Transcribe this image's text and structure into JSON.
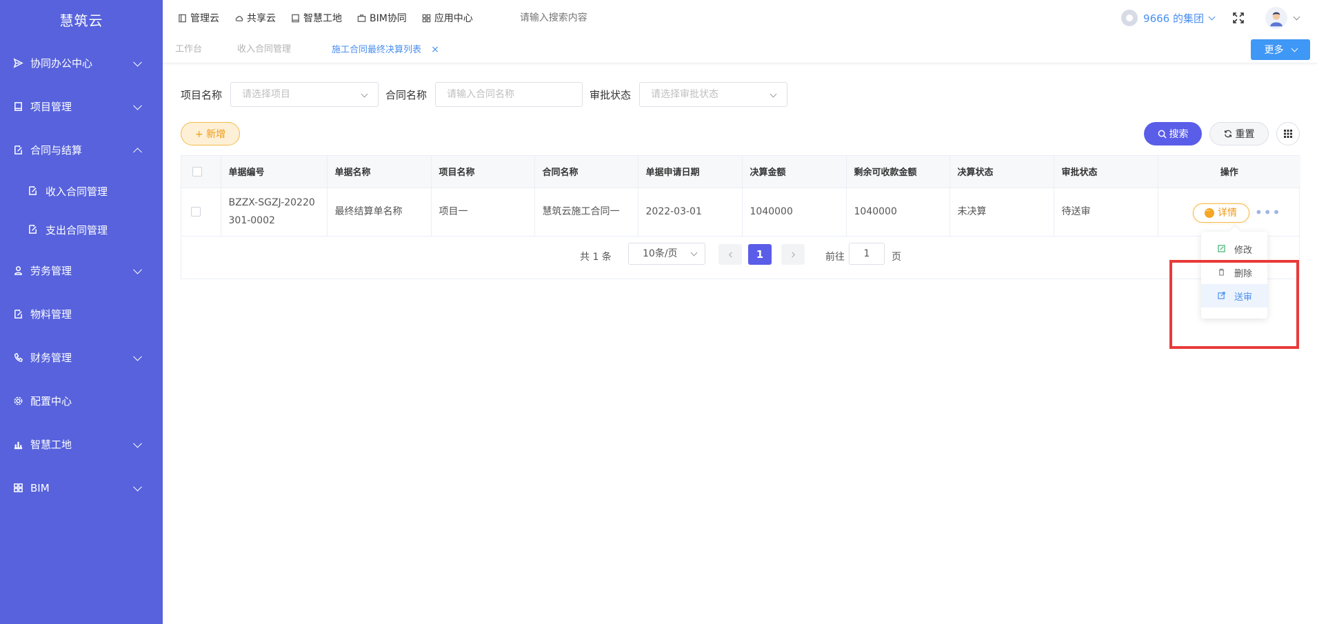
{
  "sidebar": {
    "brand": "慧筑云",
    "items": [
      {
        "label": "协同办公中心",
        "icon": "send-icon",
        "expandable": true
      },
      {
        "label": "项目管理",
        "icon": "book-icon",
        "expandable": true
      },
      {
        "label": "合同与结算",
        "icon": "edit-icon",
        "expandable": true,
        "expanded": true
      },
      {
        "label": "劳务管理",
        "icon": "worker-icon",
        "expandable": true
      },
      {
        "label": "物料管理",
        "icon": "edit-icon",
        "expandable": false
      },
      {
        "label": "财务管理",
        "icon": "phone-icon",
        "expandable": true
      },
      {
        "label": "配置中心",
        "icon": "gear-icon",
        "expandable": false
      },
      {
        "label": "智慧工地",
        "icon": "bar-chart-icon",
        "expandable": true
      },
      {
        "label": "BIM",
        "icon": "grid-icon",
        "expandable": true
      }
    ],
    "subitems": [
      {
        "label": "收入合同管理",
        "icon": "edit-icon"
      },
      {
        "label": "支出合同管理",
        "icon": "edit-icon"
      }
    ]
  },
  "topbar": {
    "links": [
      "管理云",
      "共享云",
      "智慧工地",
      "BIM协同",
      "应用中心"
    ],
    "search_placeholder": "请输入搜索内容",
    "org": "9666 的集团"
  },
  "tabs": {
    "items": [
      "工作台",
      "收入合同管理",
      "施工合同最终决算列表"
    ],
    "active_index": 2,
    "more_label": "更多"
  },
  "filters": {
    "project_label": "项目名称",
    "project_placeholder": "请选择项目",
    "contract_label": "合同名称",
    "contract_placeholder": "请输入合同名称",
    "status_label": "审批状态",
    "status_placeholder": "请选择审批状态"
  },
  "actions": {
    "add_label": "+ 新增",
    "search_label": "搜索",
    "reset_label": "重置"
  },
  "table": {
    "columns": [
      "单据编号",
      "单据名称",
      "项目名称",
      "合同名称",
      "单据申请日期",
      "决算金额",
      "剩余可收款金额",
      "决算状态",
      "审批状态",
      "操作"
    ],
    "rows": [
      {
        "doc_no": "BZZX-SGZJ-20220301-0002",
        "doc_name": "最终结算单名称",
        "project": "项目一",
        "contract": "慧筑云施工合同一",
        "date": "2022-03-01",
        "amount": "1040000",
        "remaining": "1040000",
        "settle_status": "未决算",
        "approve_status": "待送审",
        "detail_label": "详情"
      }
    ]
  },
  "pagination": {
    "total_text": "共 1 条",
    "page_size": "10条/页",
    "current_page": "1",
    "goto_label": "前往",
    "goto_value": "1",
    "page_suffix": "页"
  },
  "dropdown": {
    "items": [
      {
        "label": "修改",
        "icon": "edit-icon"
      },
      {
        "label": "删除",
        "icon": "trash-icon"
      },
      {
        "label": "送审",
        "icon": "submit-icon",
        "active": true
      }
    ]
  },
  "colors": {
    "sidebar_bg": "#5762dc",
    "primary": "#5a5de8",
    "link_blue": "#4a8ff0",
    "orange": "#f09a17",
    "highlight_red": "#e83a3a"
  }
}
